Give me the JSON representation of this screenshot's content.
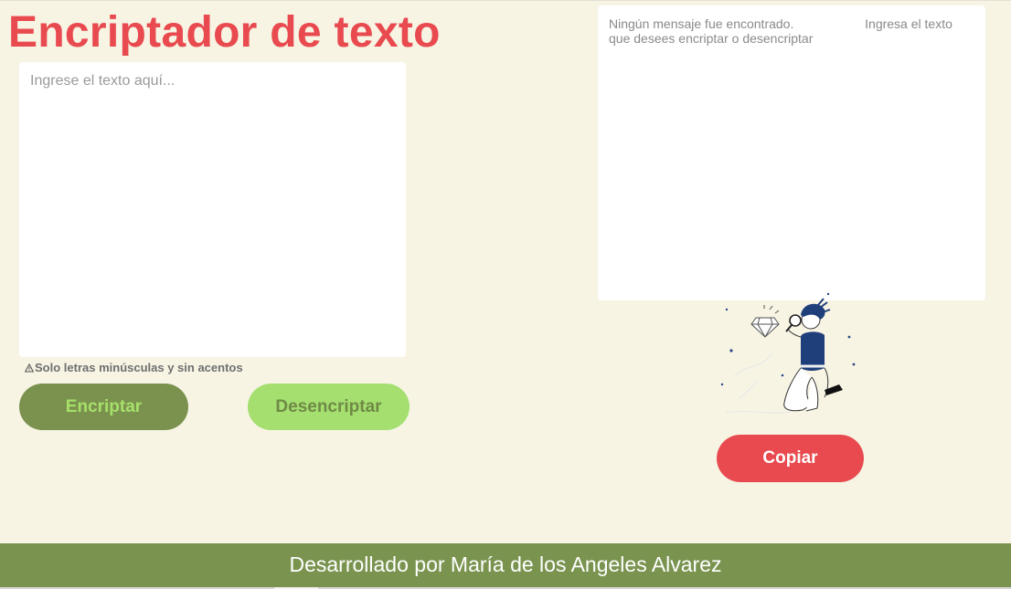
{
  "header": {
    "title": "Encriptador de texto"
  },
  "input": {
    "placeholder": "Ingrese el texto aquí...",
    "value": ""
  },
  "hint": {
    "icon": "warning-icon",
    "text": "Solo letras minúsculas y sin acentos"
  },
  "actions": {
    "encrypt_label": "Encriptar",
    "decrypt_label": "Desencriptar",
    "copy_label": "Copiar"
  },
  "output": {
    "text": "Ningún mensaje fue encontrado.                    Ingresa el texto que desees encriptar o desencriptar",
    "illustration": "person-with-magnifying-glass-illustration"
  },
  "footer": {
    "text": "Desarrollado por María de los Angeles Alvarez"
  },
  "colors": {
    "background": "#f7f4e4",
    "title": "#e84a4f",
    "encrypt_button": "#7a924e",
    "decrypt_button": "#a4df70",
    "copy_button": "#e84a4f",
    "footer": "#7a9450"
  }
}
